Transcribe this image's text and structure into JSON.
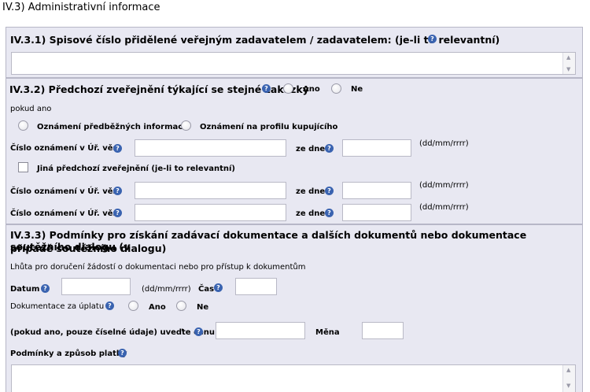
{
  "page": {
    "title": "IV.3) Administrativní informace"
  },
  "sec1": {
    "title": "IV.3.1) Spisové číslo přidělené veřejným zadavatelem / zadavatelem: (je-li to relevantní)"
  },
  "sec2": {
    "title": "IV.3.2) Předchozí zveřejnění týkající se stejné zakázky",
    "ano": "Ano",
    "ne": "Ne",
    "pokud_ano": "pokud ano",
    "opt_predbezne": "Oznámení předběžných informací",
    "opt_profil": "Oznámení na profilu kupujícího",
    "cislo_label": "Číslo oznámení v Úř. věst",
    "ze_dne": "ze dne",
    "date_hint": "(dd/mm/rrrr)",
    "jina": "Jiná předchozí zveřejnění (je-li to relevantní)"
  },
  "sec3": {
    "title_line1": "IV.3.3) Podmínky pro získání zadávací dokumentace a dalších dokumentů nebo dokumentace soutěžního dialogu (v",
    "title_line2": "případě soutěžního dialogu)",
    "lhuta": "Lhůta pro doručení žádostí o dokumentaci nebo pro přístup k dokumentům",
    "datum": "Datum",
    "date_hint": "(dd/mm/rrrr)",
    "cas": "Čas",
    "dokumentace_za_uplatu": "Dokumentace za úplatu",
    "ano": "Ano",
    "ne": "Ne",
    "cena_label": "(pokud ano, pouze číselné údaje) uveďte cenu",
    "mena": "Měna",
    "podminky": "Podmínky a způsob platby"
  },
  "icons": {
    "help": "?"
  }
}
